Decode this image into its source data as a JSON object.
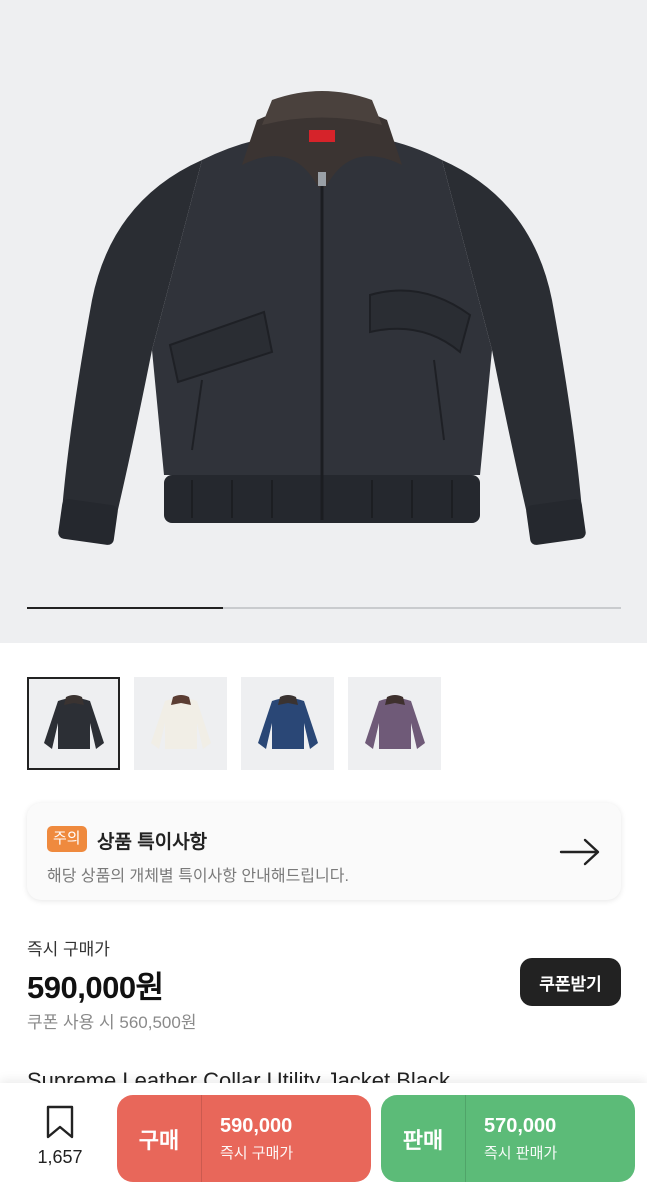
{
  "gallery": {
    "slide_progress": 0.33,
    "brand_tag": "Supreme",
    "thumbnails": [
      {
        "color": "black",
        "selected": true
      },
      {
        "color": "white",
        "selected": false
      },
      {
        "color": "navy",
        "selected": false
      },
      {
        "color": "purple",
        "selected": false
      }
    ]
  },
  "notice": {
    "tag": "주의",
    "title": "상품 특이사항",
    "description": "해당 상품의 개체별 특이사항 안내해드립니다.",
    "icon": "arrow-right-icon"
  },
  "price": {
    "label": "즉시 구매가",
    "value": "590,000원",
    "coupon_text": "쿠폰 사용 시 560,500원",
    "coupon_button": "쿠폰받기"
  },
  "product": {
    "name": "Supreme Leather Collar Utility Jacket Black"
  },
  "bottom_bar": {
    "wish_icon": "bookmark-icon",
    "wish_count": "1,657",
    "buy": {
      "label": "구매",
      "amount": "590,000",
      "sub": "즉시 구매가"
    },
    "sell": {
      "label": "판매",
      "amount": "570,000",
      "sub": "즉시 판매가"
    }
  },
  "colors": {
    "buy": "#e8675a",
    "sell": "#5cbb78",
    "notice_tag": "#ef8a3e",
    "dark": "#222222"
  }
}
